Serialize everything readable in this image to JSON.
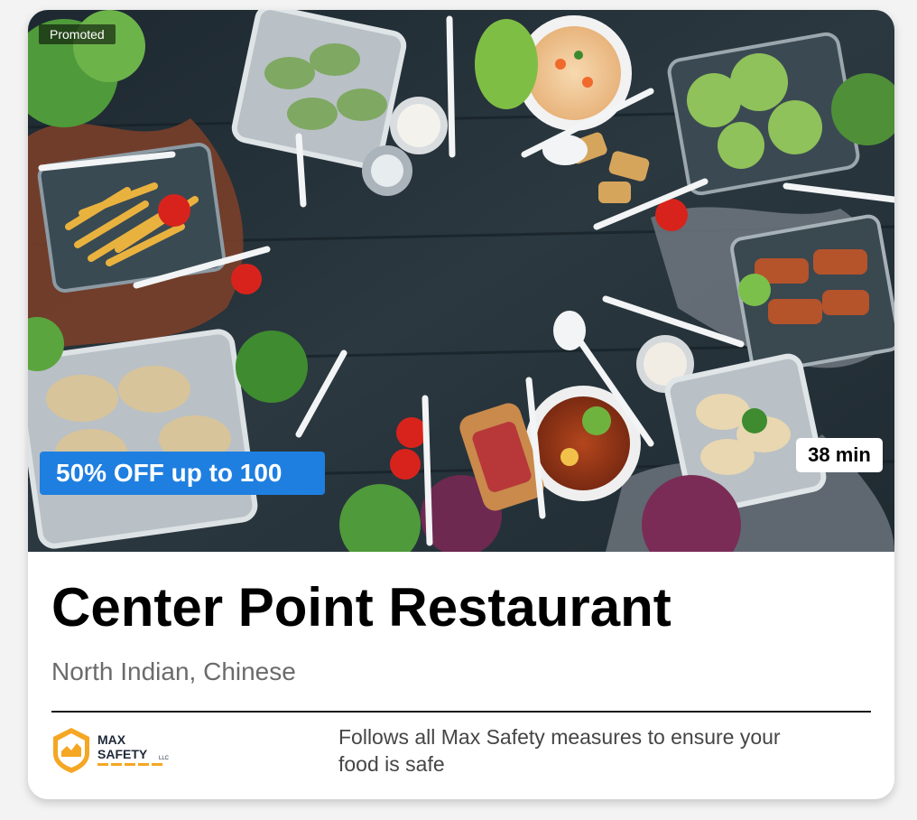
{
  "card": {
    "badge": "Promoted",
    "offer": "50% OFF up to 100",
    "delivery_time": "38 min",
    "name": "Center Point Restaurant",
    "cuisines": "North Indian, Chinese",
    "safety_logo": {
      "line1": "MAX",
      "line2": "SAFETY",
      "suffix": "LLC"
    },
    "safety_message": "Follows all Max Safety measures to ensure your food is safe"
  },
  "colors": {
    "offer_bg": "#1e7fe0",
    "logo_orange": "#f5a623",
    "table_wood": "#27333b"
  }
}
